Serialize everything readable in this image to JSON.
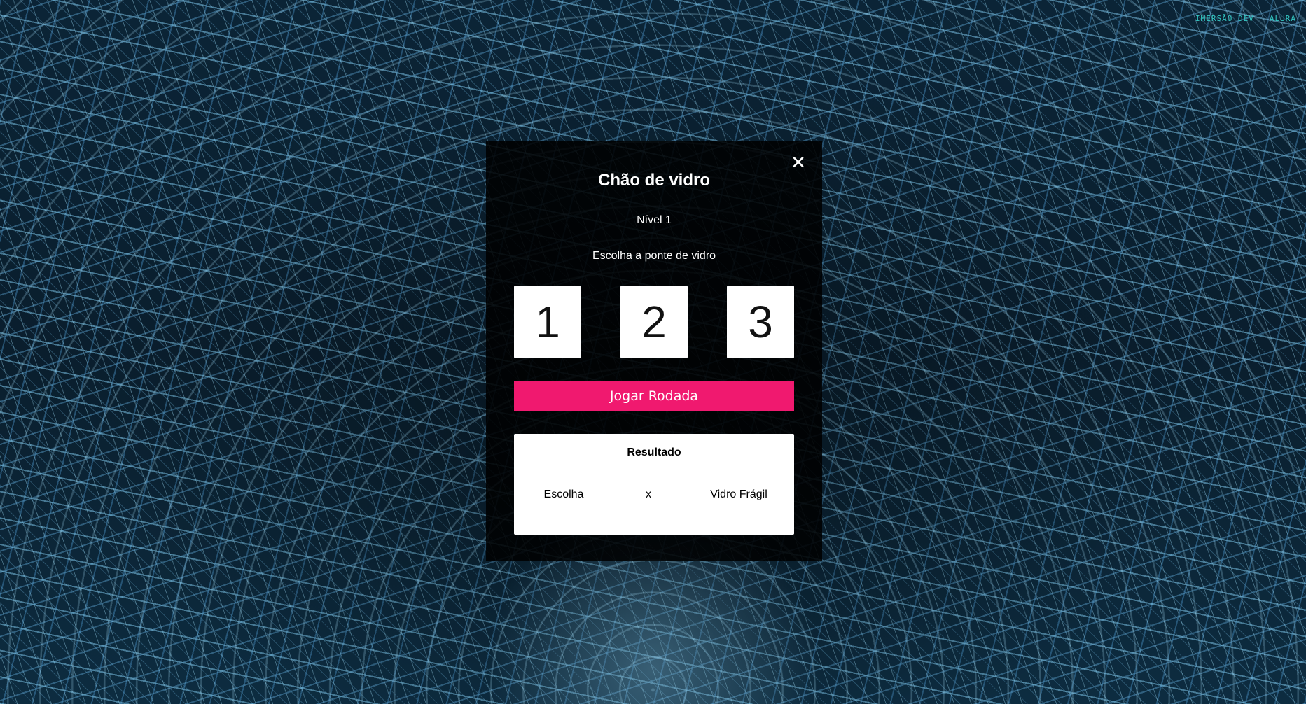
{
  "brand": {
    "imersao": "IMERSÃO DEV",
    "alura": "ALURA"
  },
  "game": {
    "title": "Chão de vidro",
    "level": "Nível 1",
    "instruction": "Escolha a ponte de vidro",
    "close_icon": "close-icon",
    "choices": [
      "1",
      "2",
      "3"
    ],
    "play_label": "Jogar Rodada",
    "accent_color": "#f0196f"
  },
  "result": {
    "title": "Resultado",
    "choice_label": "Escolha",
    "separator": "x",
    "fragile_label": "Vidro Frágil"
  }
}
